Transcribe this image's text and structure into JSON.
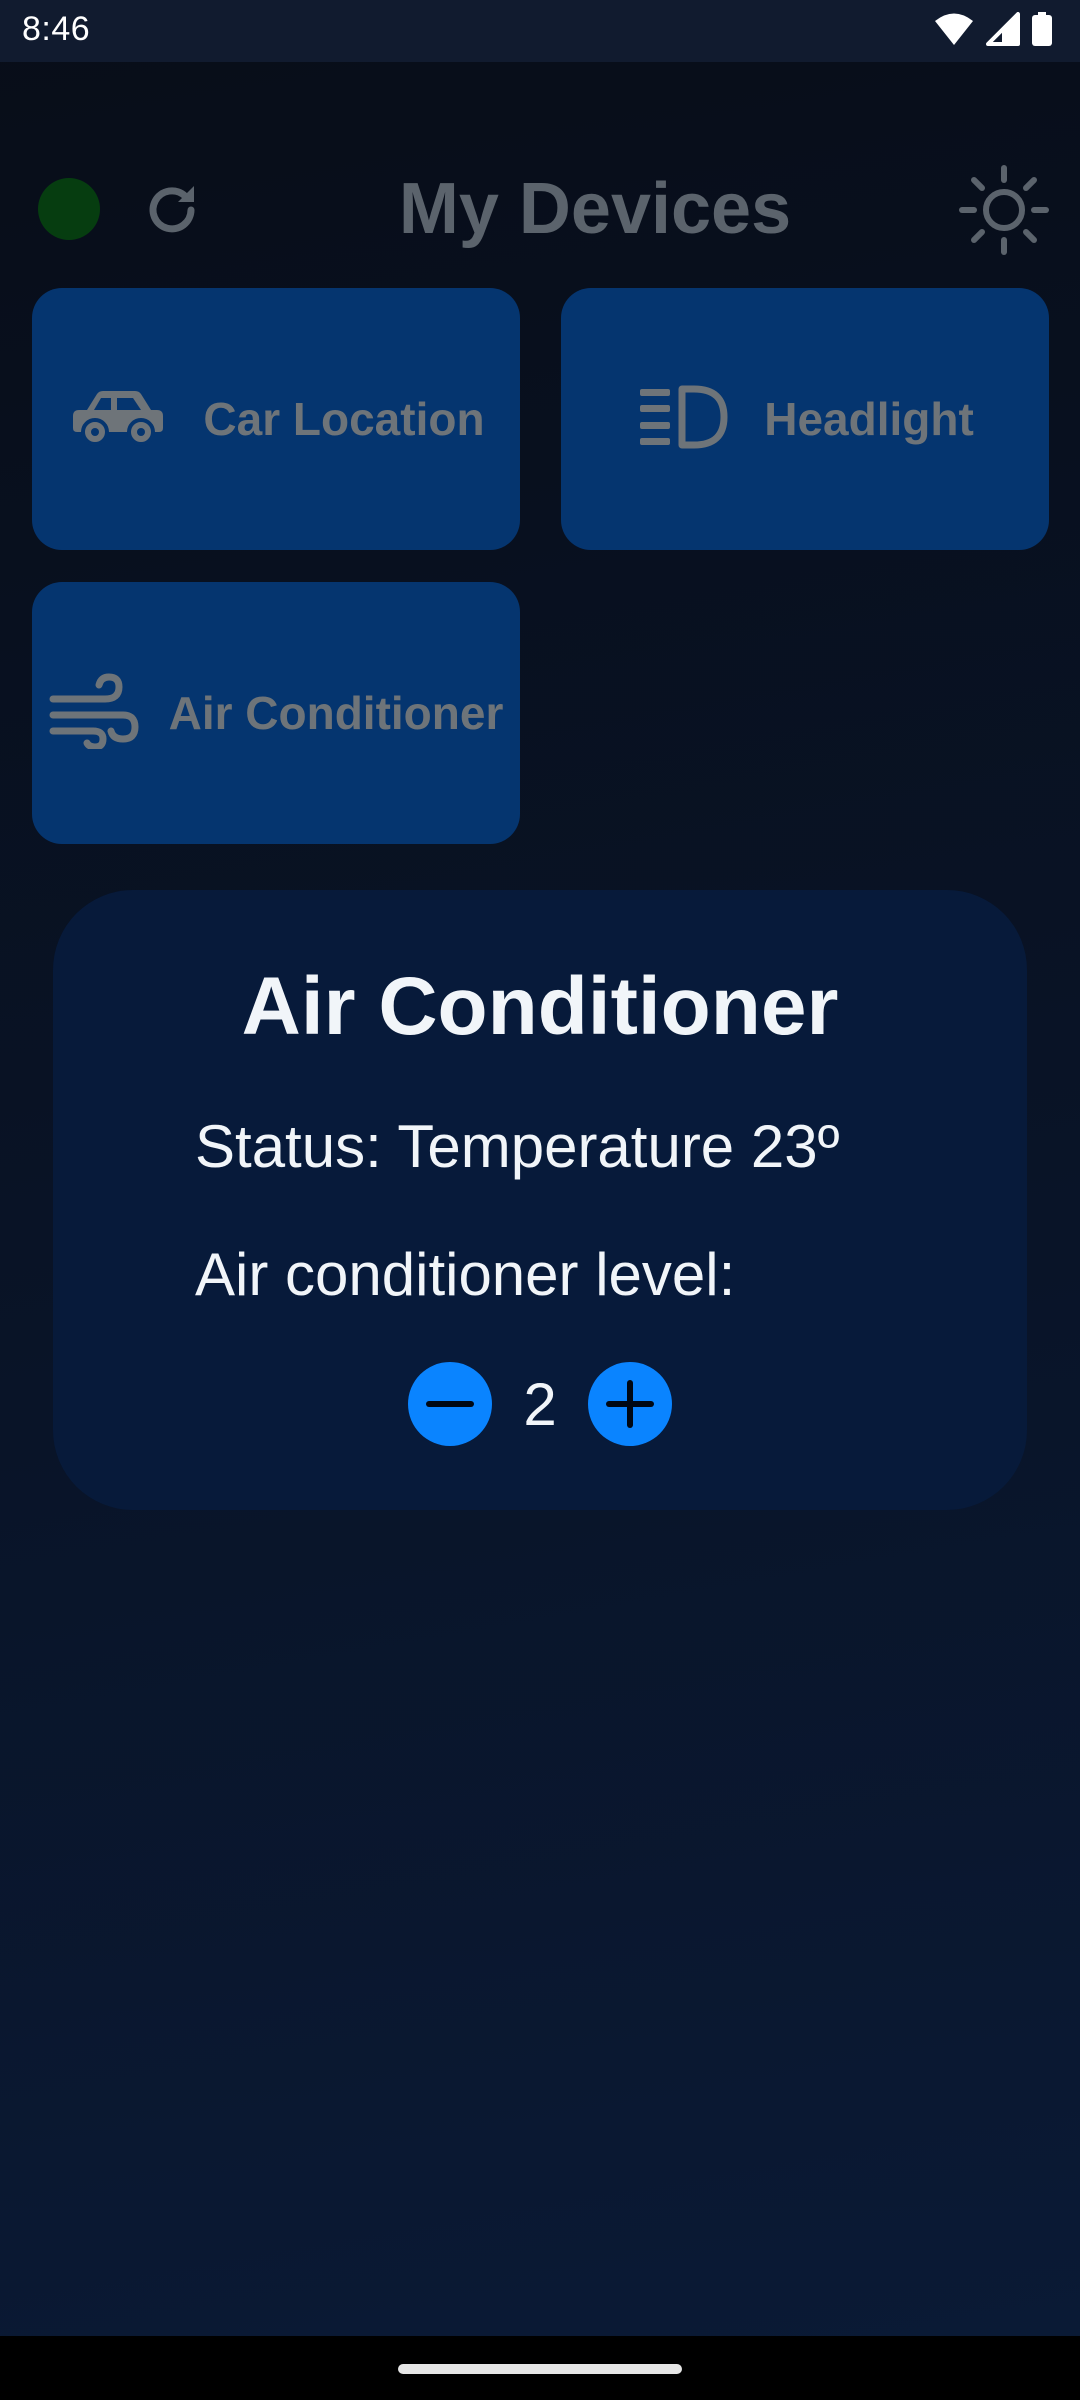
{
  "status_bar": {
    "time": "8:46",
    "icons": [
      "wifi-icon",
      "signal-icon",
      "battery-icon"
    ]
  },
  "header": {
    "title": "My Devices",
    "connection_color": "#063d10",
    "icons": [
      "status-dot",
      "refresh-icon",
      "sun-icon"
    ]
  },
  "devices": [
    {
      "label": "Car Location",
      "icon": "car-icon"
    },
    {
      "label": "Headlight",
      "icon": "headlight-icon"
    },
    {
      "label": "Air Conditioner",
      "icon": "wind-icon"
    }
  ],
  "modal": {
    "title": "Air Conditioner",
    "status": "Status: Temperature 23º",
    "level_label": "Air conditioner level:",
    "level_value": "2",
    "decrease_icon": "minus-icon",
    "increase_icon": "plus-icon"
  },
  "colors": {
    "accent": "#0a84ff",
    "card": "#05356f",
    "modal": "#071a3a"
  }
}
